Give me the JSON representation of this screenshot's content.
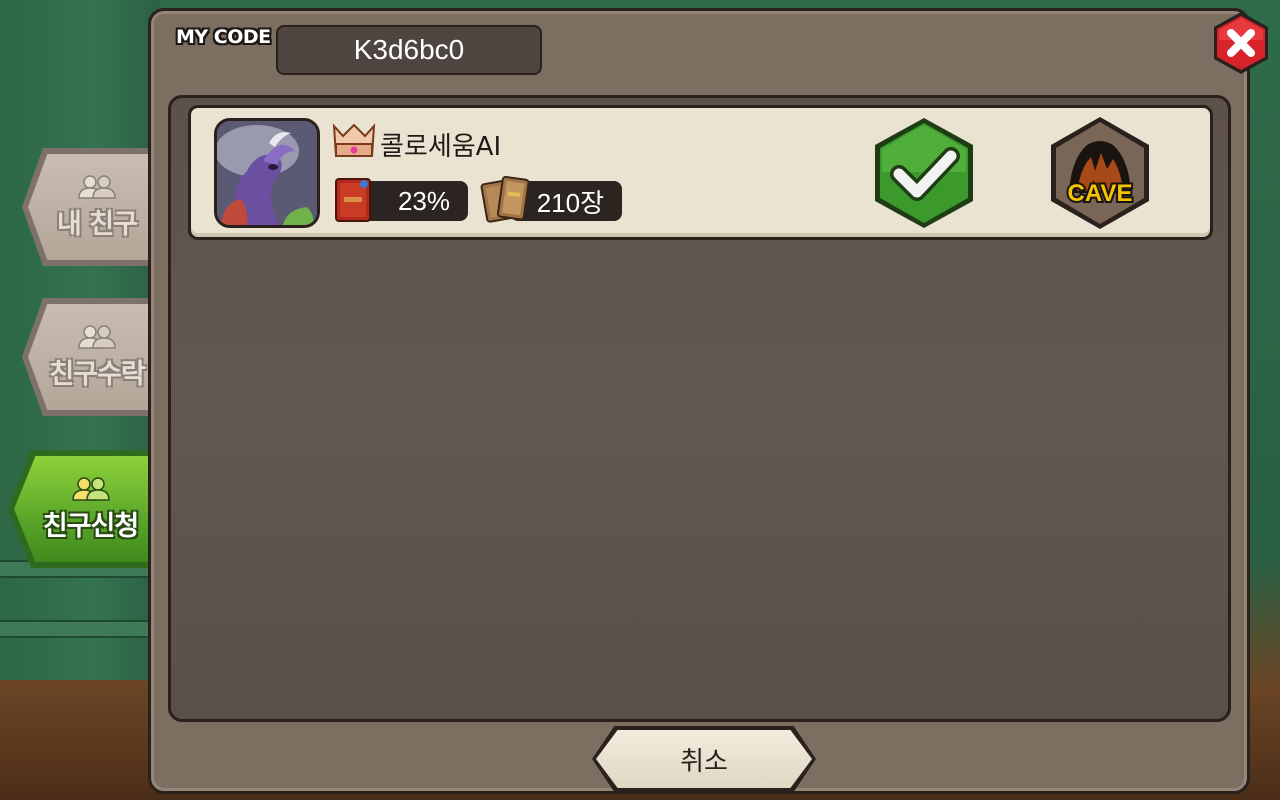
{
  "header": {
    "mycode_label": "MY CODE",
    "mycode_value": "K3d6bc0"
  },
  "tabs": [
    {
      "label": "내 친구",
      "active": false
    },
    {
      "label": "친구수락",
      "active": false
    },
    {
      "label": "친구신청",
      "active": true
    }
  ],
  "friends": [
    {
      "name": "콜로세움AI",
      "progress": "23%",
      "cards": "210장",
      "accept_icon": "checkmark-icon",
      "cave_label": "CAVE"
    }
  ],
  "footer": {
    "cancel_label": "취소"
  },
  "colors": {
    "panel": "#7d6e62",
    "inner_panel": "#5d524a",
    "row": "#eae3d2",
    "accept_green": "#3c9a2c",
    "close_red": "#d9232a",
    "active_tab": "#5aa62a",
    "cave_text": "#f5c400"
  }
}
